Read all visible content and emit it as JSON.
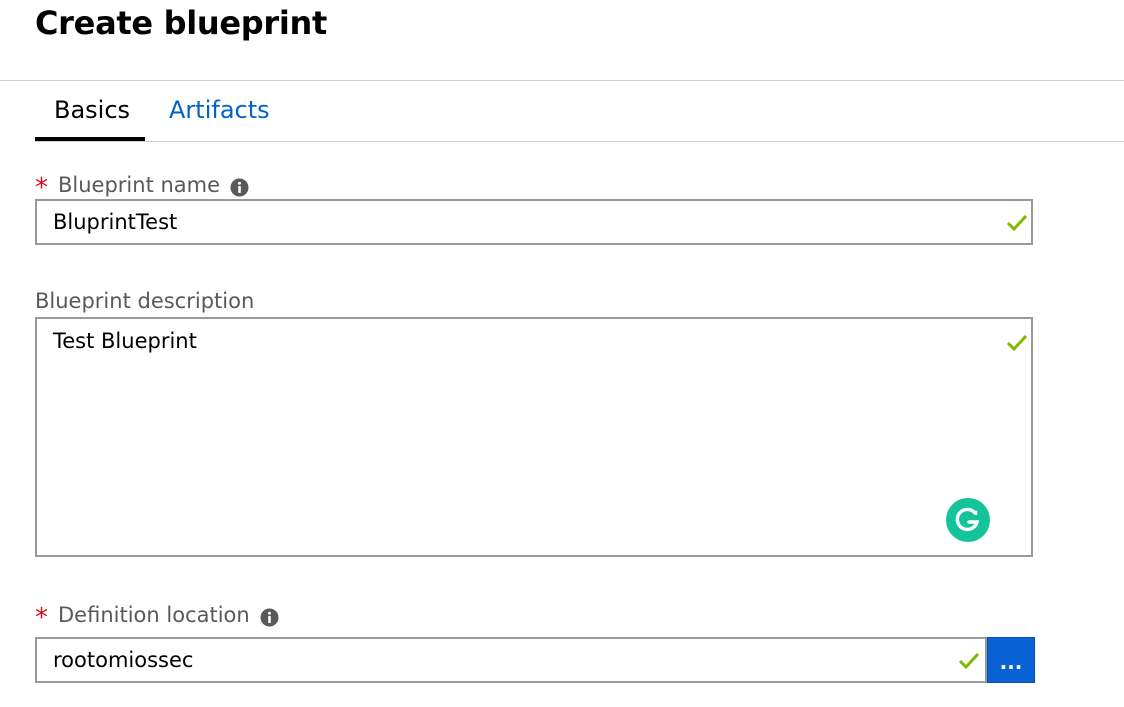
{
  "page": {
    "title": "Create blueprint"
  },
  "tabs": [
    {
      "label": "Basics",
      "selected": true
    },
    {
      "label": "Artifacts",
      "selected": false
    }
  ],
  "form": {
    "blueprint_name": {
      "label": "Blueprint name",
      "required_marker": "*",
      "value": "BluprintTest",
      "valid": true
    },
    "blueprint_description": {
      "label": "Blueprint description",
      "value": "Test Blueprint",
      "valid": true
    },
    "definition_location": {
      "label": "Definition location",
      "required_marker": "*",
      "value": "rootomiossec",
      "valid": true,
      "browse_label": "..."
    }
  },
  "colors": {
    "accent_link": "#0063c7",
    "required": "#e00b1c",
    "valid_check": "#7fba00",
    "browse_button": "#0a63d6",
    "grammarly": "#15c39a"
  },
  "icons": {
    "info": "info-icon",
    "valid": "checkmark-icon",
    "grammarly": "grammarly-icon"
  }
}
